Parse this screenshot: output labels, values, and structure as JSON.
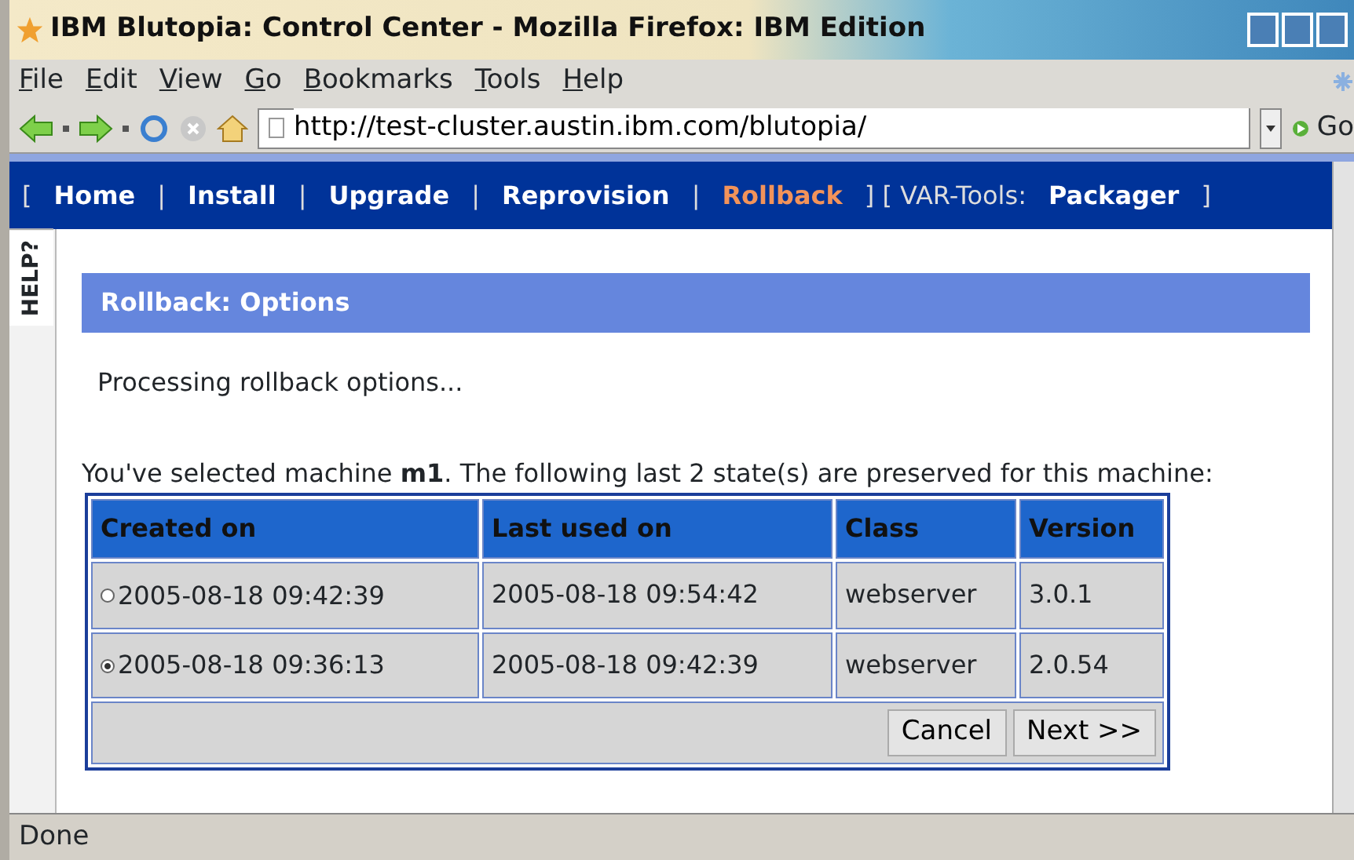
{
  "window": {
    "title": "IBM Blutopia: Control Center - Mozilla Firefox: IBM Edition"
  },
  "menu": [
    "File",
    "Edit",
    "View",
    "Go",
    "Bookmarks",
    "Tools",
    "Help"
  ],
  "address_bar": {
    "url": "http://test-cluster.austin.ibm.com/blutopia/",
    "go_label": "Go"
  },
  "nav": [
    {
      "kind": "text",
      "text": "["
    },
    {
      "kind": "link",
      "text": "Home",
      "selected": false
    },
    {
      "kind": "text",
      "text": "|"
    },
    {
      "kind": "link",
      "text": "Install",
      "selected": false
    },
    {
      "kind": "text",
      "text": "|"
    },
    {
      "kind": "link",
      "text": "Upgrade",
      "selected": false
    },
    {
      "kind": "text",
      "text": "|"
    },
    {
      "kind": "link",
      "text": "Reprovision",
      "selected": false
    },
    {
      "kind": "text",
      "text": "|"
    },
    {
      "kind": "link",
      "text": "Rollback",
      "selected": true
    },
    {
      "kind": "text",
      "text": "] [ VAR-Tools:"
    },
    {
      "kind": "link",
      "text": "Packager",
      "selected": false
    },
    {
      "kind": "text",
      "text": "]"
    }
  ],
  "help_tab": "HELP?",
  "section_title": "Rollback: Options",
  "status_message": "Processing rollback options...",
  "intro": "You've selected machine **m1**. The following last 2 state(s) are preserved for this machine:",
  "table": {
    "columns": [
      "Created on",
      "Last used on",
      "Class",
      "Version"
    ],
    "rows": [
      {
        "selected": false,
        "cells": [
          "2005-08-18 09:42:39",
          "2005-08-18 09:54:42",
          "webserver",
          "3.0.1"
        ]
      },
      {
        "selected": true,
        "cells": [
          "2005-08-18 09:36:13",
          "2005-08-18 09:42:39",
          "webserver",
          "2.0.54"
        ]
      }
    ]
  },
  "buttons": [
    "Cancel",
    "Next >>"
  ],
  "status_bar": "Done"
}
